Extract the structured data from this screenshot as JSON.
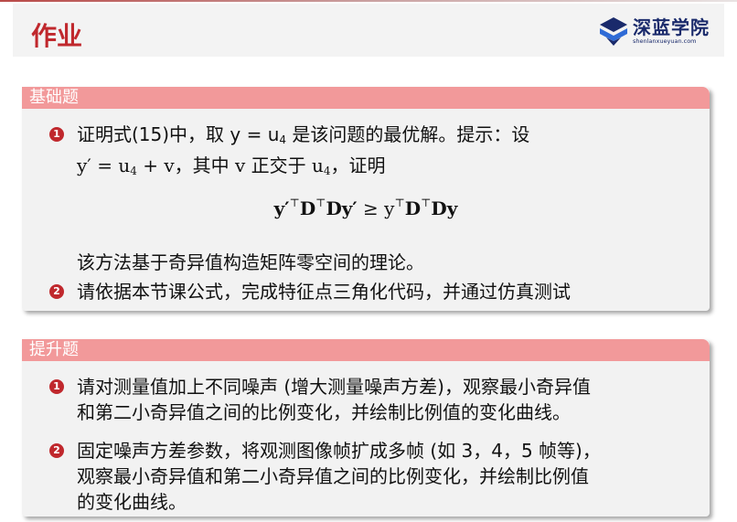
{
  "header": {
    "title": "作业",
    "logo_name": "深蓝学院",
    "logo_url": "shenlanxueyuan.com"
  },
  "basic": {
    "title": "基础题",
    "items": [
      {
        "number": "1",
        "line1": "证明式(15)中，取 y = u",
        "line1_sub": "4",
        "line1_tail": " 是该问题的最优解。提示：设",
        "line2_a": "y′ = u",
        "line2_sub1": "4",
        "line2_b": " + v，其中 v 正交于 u",
        "line2_sub2": "4",
        "line2_c": "，证明",
        "equation": {
          "y1": "y′",
          "t": "⊤",
          "D1": "D",
          "D2": "Dy′",
          "geq": " ≥ y",
          "D3": "D",
          "D4": "Dy"
        },
        "line3": "该方法基于奇异值构造矩阵零空间的理论。"
      },
      {
        "number": "2",
        "line1": "请依据本节课公式，完成特征点三角化代码，并通过仿真测试"
      }
    ]
  },
  "advanced": {
    "title": "提升题",
    "items": [
      {
        "number": "1",
        "line1": "请对测量值加上不同噪声 (增大测量噪声方差)，观察最小奇异值",
        "line2": "和第二小奇异值之间的比例变化，并绘制比例值的变化曲线。"
      },
      {
        "number": "2",
        "line1": "固定噪声方差参数，将观测图像帧扩成多帧 (如 3，4，5 帧等)，",
        "line2": "观察最小奇异值和第二小奇异值之间的比例变化，并绘制比例值",
        "line3": "的变化曲线。"
      }
    ]
  },
  "colors": {
    "accent": "#c0282d",
    "block_header": "#f2999a",
    "block_body": "#f2f2f2",
    "logo": "#1a2a6b"
  }
}
